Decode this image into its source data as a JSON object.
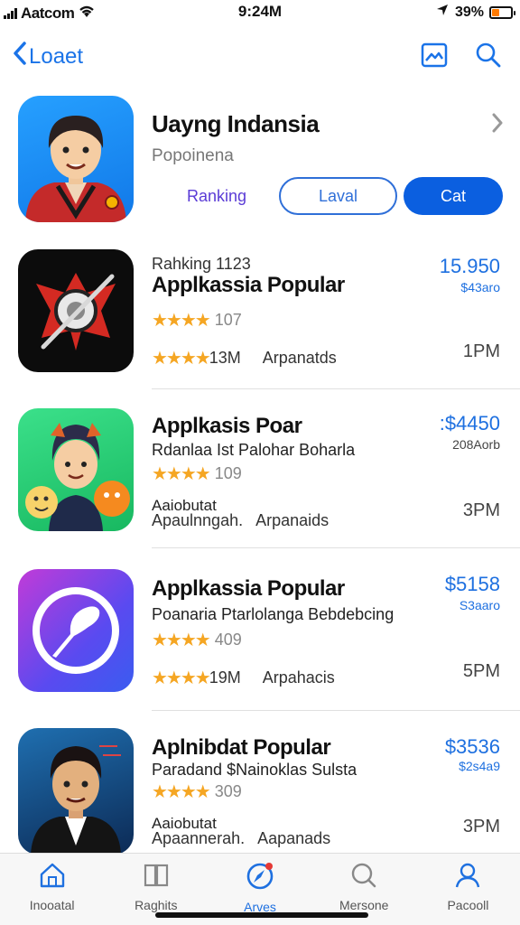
{
  "status": {
    "carrier": "Aatcom",
    "time": "9:24M",
    "battery": "39%",
    "battery_level": 0.39
  },
  "nav": {
    "back_label": "Loaet"
  },
  "header": {
    "title": "Uayng Indansia",
    "subtitle": "Popoinena",
    "segments": {
      "ranking": "Ranking",
      "laval": "Laval",
      "cat": "Cat"
    }
  },
  "apps": [
    {
      "top_label": "Rahking 1123",
      "name": "Applkassia Popular",
      "stars": "★★★★",
      "rating": "107",
      "price": "15.950",
      "sub_price": "$43aro",
      "stars2": "★★★★",
      "count": "13M",
      "category": "Arpanatds",
      "time": "1PM"
    },
    {
      "name": "Applkasis Poar",
      "desc": "Rdanlaa Ist Palohar Boharla",
      "stars": "★★★★",
      "rating": "109",
      "price": ":$4450",
      "sub_price": "208Aorb",
      "line1": "Aaiobutat",
      "line2": "Apaulnngah.",
      "category": "Arpanaids",
      "time": "3PM"
    },
    {
      "name": "Applkassia Popular",
      "desc": "Poanaria Ptarlolanga Bebdebcing",
      "stars": "★★★★",
      "rating": "409",
      "price": "$5158",
      "sub_price": "S3aaro",
      "stars2": "★★★★",
      "count": "19M",
      "category": "Arpahacis",
      "time": "5PM"
    },
    {
      "name": "Aplnibdat Popular",
      "desc": "Paradand $Nainoklas Sulsta",
      "stars": "★★★★",
      "rating": "309",
      "price": "$3536",
      "sub_price": "$2s4a9",
      "line1": "Aaiobutat",
      "line2": "Apaannerah.",
      "category": "Aapanads",
      "time": "3PM"
    }
  ],
  "tabs": [
    {
      "label": "Inooatal",
      "icon": "home-icon"
    },
    {
      "label": "Raghits",
      "icon": "book-icon"
    },
    {
      "label": "Arves",
      "icon": "compass-icon"
    },
    {
      "label": "Mersone",
      "icon": "search-icon"
    },
    {
      "label": "Pacooll",
      "icon": "person-icon"
    }
  ],
  "colors": {
    "accent": "#1e70e0",
    "star": "#f5a623",
    "primary_button": "#0b5fe0"
  }
}
